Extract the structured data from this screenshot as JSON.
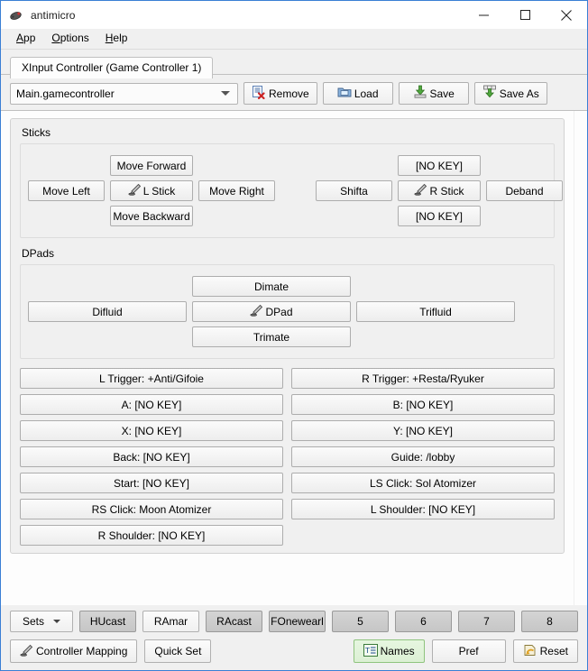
{
  "window": {
    "title": "antimicro",
    "icon": "gamepad-icon",
    "controls": {
      "minimize": "minimize-icon",
      "maximize": "maximize-icon",
      "close": "close-icon"
    }
  },
  "menubar": {
    "items": [
      {
        "label": "App",
        "mnemonic": "A"
      },
      {
        "label": "Options",
        "mnemonic": "O"
      },
      {
        "label": "Help",
        "mnemonic": "H"
      }
    ]
  },
  "tabs": [
    {
      "label": "XInput Controller (Game Controller 1)",
      "active": true
    }
  ],
  "profilebar": {
    "profile_combo": {
      "value": "Main.gamecontroller",
      "icon": "chevron-down-icon"
    },
    "buttons": [
      {
        "label": "Remove",
        "icon": "remove-document-icon"
      },
      {
        "label": "Load",
        "icon": "folder-open-icon"
      },
      {
        "label": "Save",
        "icon": "save-down-arrow-icon"
      },
      {
        "label": "Save As",
        "icon": "save-as-icon"
      }
    ]
  },
  "sticks": {
    "title": "Sticks",
    "left_stick": {
      "up": "Move Forward",
      "left": "Move Left",
      "center": "L Stick",
      "center_icon": "stick-config-icon",
      "right": "Move Right",
      "down": "Move Backward"
    },
    "right_stick": {
      "up": "[NO KEY]",
      "left": "Shifta",
      "center": "R Stick",
      "center_icon": "stick-config-icon",
      "right": "Deband",
      "down": "[NO KEY]"
    }
  },
  "dpads": {
    "title": "DPads",
    "dpad": {
      "up": "Dimate",
      "left": "Difluid",
      "center": "DPad",
      "center_icon": "dpad-config-icon",
      "right": "Trifluid",
      "down": "Trimate"
    }
  },
  "button_matrix": [
    {
      "left": "L Trigger: +Anti/Gifoie",
      "right": "R Trigger: +Resta/Ryuker"
    },
    {
      "left": "A: [NO KEY]",
      "right": "B: [NO KEY]"
    },
    {
      "left": "X: [NO KEY]",
      "right": "Y: [NO KEY]"
    },
    {
      "left": "Back: [NO KEY]",
      "right": "Guide: /lobby"
    },
    {
      "left": "Start: [NO KEY]",
      "right": "LS Click: Sol Atomizer"
    },
    {
      "left": "RS Click: Moon Atomizer",
      "right": "L Shoulder: [NO KEY]"
    },
    {
      "left": "R Shoulder: [NO KEY]",
      "right": ""
    }
  ],
  "sets": {
    "combo_label": "Sets",
    "combo_icon": "chevron-down-icon",
    "items": [
      {
        "label": "HUcast",
        "active": true
      },
      {
        "label": "RAmar",
        "active": false
      },
      {
        "label": "RAcast",
        "active": true
      },
      {
        "label": "FOnewearl",
        "active": true
      },
      {
        "label": "5",
        "active": true
      },
      {
        "label": "6",
        "active": true
      },
      {
        "label": "7",
        "active": true
      },
      {
        "label": "8",
        "active": true
      }
    ]
  },
  "actions": {
    "left": [
      {
        "label": "Controller Mapping",
        "icon": "controller-mapping-icon",
        "highlight": false
      },
      {
        "label": "Quick Set",
        "icon": "",
        "highlight": false
      }
    ],
    "right": [
      {
        "label": "Names",
        "icon": "names-text-icon",
        "highlight": true
      },
      {
        "label": "Pref",
        "icon": "",
        "highlight": false
      },
      {
        "label": "Reset",
        "icon": "reset-undo-icon",
        "highlight": false
      }
    ]
  },
  "colors": {
    "window_border": "#3a7fd5",
    "panel_bg": "#f0f0f0",
    "content_bg": "#fdfdfd",
    "names_green": "#dcf0d4",
    "set_active": "#cbcbcb"
  }
}
